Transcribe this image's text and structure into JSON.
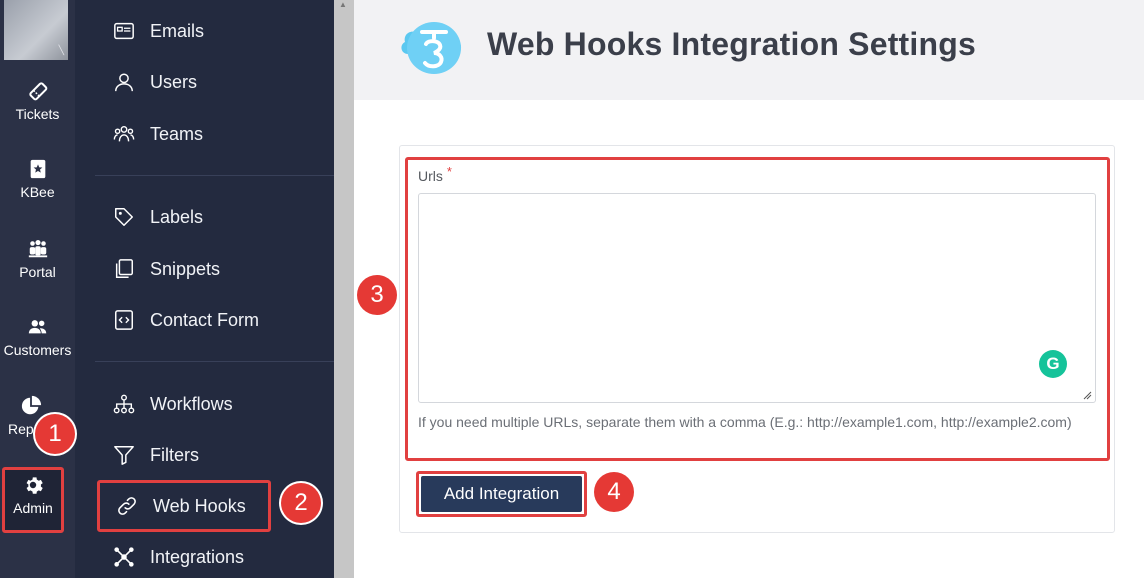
{
  "rail": {
    "items": [
      {
        "label": "Tickets",
        "icon": "ticket-icon"
      },
      {
        "label": "KBee",
        "icon": "kb-book-icon"
      },
      {
        "label": "Portal",
        "icon": "portal-people-icon"
      },
      {
        "label": "Customers",
        "icon": "customers-icon"
      },
      {
        "label": "Repo",
        "icon": "reports-pie-icon"
      },
      {
        "label": "Admin",
        "icon": "gear-icon"
      }
    ]
  },
  "sidebar": {
    "items": [
      {
        "label": "Emails",
        "icon": "email-icon"
      },
      {
        "label": "Users",
        "icon": "user-icon"
      },
      {
        "label": "Teams",
        "icon": "teams-icon"
      },
      {
        "label": "Labels",
        "icon": "tag-icon"
      },
      {
        "label": "Snippets",
        "icon": "snippets-icon"
      },
      {
        "label": "Contact Form",
        "icon": "code-icon"
      },
      {
        "label": "Workflows",
        "icon": "workflow-icon"
      },
      {
        "label": "Filters",
        "icon": "filter-icon"
      },
      {
        "label": "Web Hooks",
        "icon": "link-icon"
      },
      {
        "label": "Integrations",
        "icon": "integrations-icon"
      }
    ]
  },
  "header": {
    "title": "Web Hooks Integration Settings"
  },
  "form": {
    "urls_label": "Urls",
    "required_mark": "*",
    "urls_value": "",
    "help_text": "If you need multiple URLs, separate them with a comma (E.g.: http://example1.com, http://example2.com)",
    "submit_label": "Add Integration"
  },
  "markers": [
    "1",
    "2",
    "3",
    "4"
  ],
  "colors": {
    "rail_bg": "#2b3146",
    "sidebar_bg": "#232a3f",
    "highlight": "#e14040",
    "button_bg": "#283a5b",
    "marker_bg": "#e53935"
  }
}
